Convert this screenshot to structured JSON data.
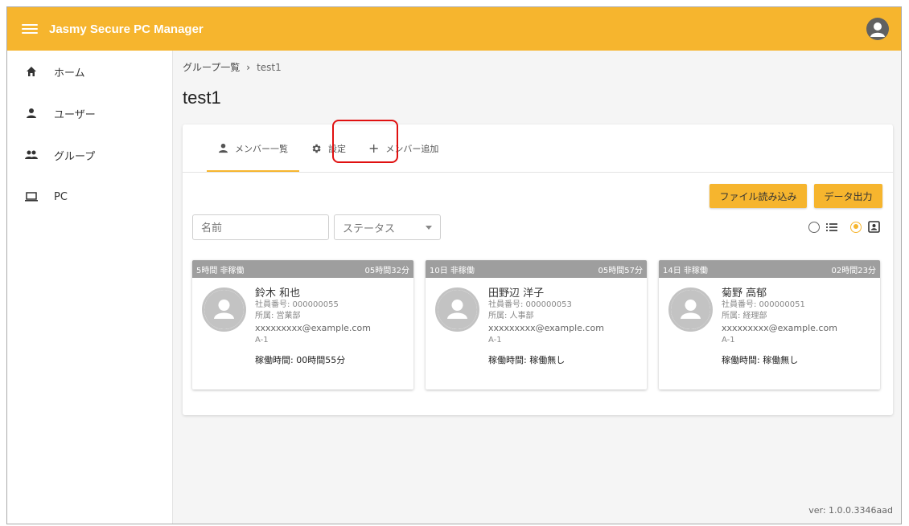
{
  "appbar": {
    "title": "Jasmy Secure PC Manager"
  },
  "sidebar": {
    "items": [
      {
        "label": "ホーム",
        "icon": "home-icon"
      },
      {
        "label": "ユーザー",
        "icon": "person-icon"
      },
      {
        "label": "グループ",
        "icon": "group-icon"
      },
      {
        "label": "PC",
        "icon": "laptop-icon"
      }
    ]
  },
  "breadcrumb": {
    "parent": "グループ一覧",
    "separator": "›",
    "current": "test1"
  },
  "page": {
    "title": "test1"
  },
  "tabs": [
    {
      "label": "メンバー一覧",
      "icon": "person-icon"
    },
    {
      "label": "設定",
      "icon": "gear-icon"
    },
    {
      "label": "メンバー追加",
      "icon": "plus-icon"
    }
  ],
  "actions": {
    "import_label": "ファイル読み込み",
    "export_label": "データ出力"
  },
  "filters": {
    "name_placeholder": "名前",
    "status_label": "ステータス"
  },
  "cards": [
    {
      "status": "5時間 非稼働",
      "duration": "05時間32分",
      "name": "鈴木 和也",
      "employee_no": "社員番号: 000000055",
      "dept": "所属: 営業部",
      "email": "xxxxxxxxx@example.com",
      "pc": "A-1",
      "uptime": "稼働時間: 00時間55分"
    },
    {
      "status": "10日 非稼働",
      "duration": "05時間57分",
      "name": "田野辺 洋子",
      "employee_no": "社員番号: 000000053",
      "dept": "所属: 人事部",
      "email": "xxxxxxxxx@example.com",
      "pc": "A-1",
      "uptime": "稼働時間: 稼働無し"
    },
    {
      "status": "14日 非稼働",
      "duration": "02時間23分",
      "name": "菊野 高郁",
      "employee_no": "社員番号: 000000051",
      "dept": "所属: 経理部",
      "email": "xxxxxxxxx@example.com",
      "pc": "A-1",
      "uptime": "稼働時間: 稼働無し"
    }
  ],
  "footer": {
    "version": "ver: 1.0.0.3346aad"
  },
  "colors": {
    "accent": "#f6b52e",
    "card_header": "#9e9e9e",
    "highlight": "#e01010"
  }
}
